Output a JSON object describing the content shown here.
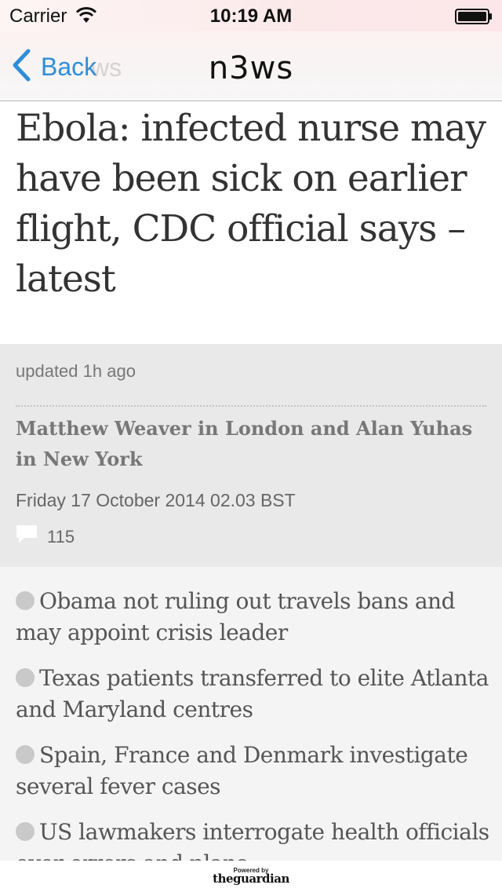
{
  "status": {
    "carrier": "Carrier",
    "time": "10:19 AM"
  },
  "nav": {
    "back_label": "Back",
    "ghost_text": "ws",
    "title": "n3ws"
  },
  "article": {
    "headline": "Ebola: infected nurse may have been sick on earlier flight, CDC official says – latest",
    "updated": "updated 1h ago",
    "byline": "Matthew Weaver in London and Alan Yuhas in New York",
    "date": "Friday 17 October 2014 02.03 BST",
    "comment_count": "115",
    "bullets": [
      "Obama not ruling out travels bans and may appoint crisis leader",
      "Texas patients transferred to elite Atlanta and Maryland centres",
      "Spain, France and Denmark investigate several fever cases",
      "US lawmakers interrogate health officials over errors and plans"
    ]
  },
  "footer": {
    "powered_by": "Powered by",
    "brand": "theguardian"
  },
  "icons": {
    "back": "chevron-left-icon",
    "wifi": "wifi-icon",
    "battery": "battery-icon",
    "comments": "comment-bubble-icon",
    "bullet": "bullet-dot"
  },
  "colors": {
    "link_blue": "#2f8ed8",
    "headline_text": "#333333",
    "meta_bg": "#e9e9e9",
    "bullets_bg": "#f4f4f4"
  }
}
